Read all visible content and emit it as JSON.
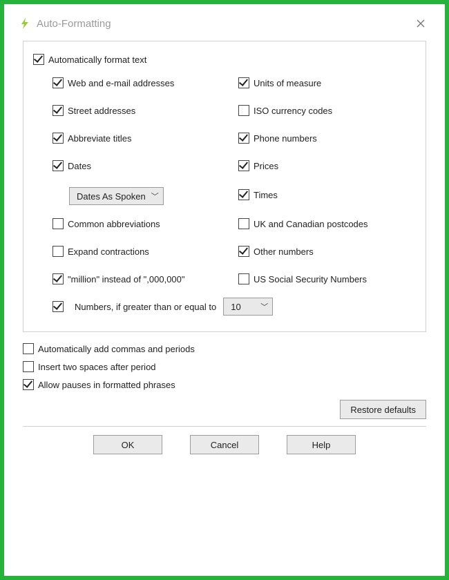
{
  "window": {
    "title": "Auto-Formatting"
  },
  "group": {
    "autoFormat": {
      "label": "Automatically format text",
      "checked": true
    },
    "left": {
      "webEmail": {
        "label": "Web and e-mail addresses",
        "checked": true
      },
      "street": {
        "label": "Street addresses",
        "checked": true
      },
      "abbrevTitles": {
        "label": "Abbreviate titles",
        "checked": true
      },
      "dates": {
        "label": "Dates",
        "checked": true
      },
      "datesMode": {
        "value": "Dates As Spoken"
      },
      "commonAbbrev": {
        "label": "Common abbreviations",
        "checked": false
      },
      "expandContr": {
        "label": "Expand contractions",
        "checked": false
      },
      "million": {
        "label": "\"million\" instead of \",000,000\"",
        "checked": true
      }
    },
    "right": {
      "units": {
        "label": "Units of measure",
        "checked": true
      },
      "iso": {
        "label": "ISO currency codes",
        "checked": false
      },
      "phone": {
        "label": "Phone numbers",
        "checked": true
      },
      "prices": {
        "label": "Prices",
        "checked": true
      },
      "times": {
        "label": "Times",
        "checked": true
      },
      "ukca": {
        "label": "UK and Canadian postcodes",
        "checked": false
      },
      "otherNums": {
        "label": "Other numbers",
        "checked": true
      },
      "ssn": {
        "label": "US Social Security Numbers",
        "checked": false
      }
    },
    "numbersThreshold": {
      "label": "Numbers, if greater than or equal to",
      "checked": true,
      "value": "10"
    }
  },
  "extra": {
    "autoCommas": {
      "label": "Automatically add commas and periods",
      "checked": false
    },
    "twoSpaces": {
      "label": "Insert two spaces after period",
      "checked": false
    },
    "allowPauses": {
      "label": "Allow pauses in formatted phrases",
      "checked": true
    }
  },
  "buttons": {
    "restore": "Restore defaults",
    "ok": "OK",
    "cancel": "Cancel",
    "help": "Help"
  }
}
